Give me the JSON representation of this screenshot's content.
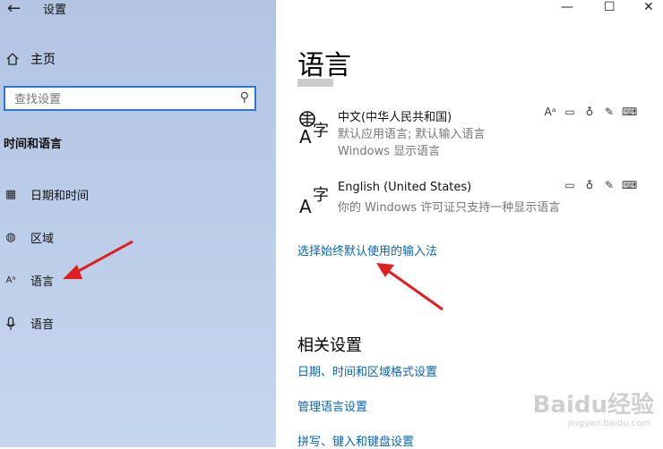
{
  "window": {
    "title": "设置"
  },
  "sidebar": {
    "home_label": "主页",
    "search_placeholder": "查找设置",
    "section_title": "时间和语言",
    "items": [
      {
        "label": "日期和时间",
        "icon": "calendar-clock-icon"
      },
      {
        "label": "区域",
        "icon": "globe-icon"
      },
      {
        "label": "语言",
        "icon": "language-icon"
      },
      {
        "label": "语音",
        "icon": "microphone-icon"
      }
    ]
  },
  "main": {
    "title": "语言",
    "languages": [
      {
        "name": "中文(中华人民共和国)",
        "desc1": "默认应用语言; 默认输入语言",
        "desc2": "Windows 显示语言"
      },
      {
        "name": "English (United States)",
        "desc1": "你的 Windows 许可证只支持一种显示语言",
        "desc2": ""
      }
    ],
    "input_method_link": "选择始终默认使用的输入法",
    "related": {
      "title": "相关设置",
      "links": [
        "日期、时间和区域格式设置",
        "管理语言设置",
        "拼写、键入和键盘设置"
      ]
    }
  },
  "watermark": {
    "text": "Baidu经验",
    "sub": "jingyan.baidu.com"
  },
  "colors": {
    "accent": "#0a64b6",
    "arrow": "#e02020",
    "sidebar": "#b9cbe7"
  }
}
